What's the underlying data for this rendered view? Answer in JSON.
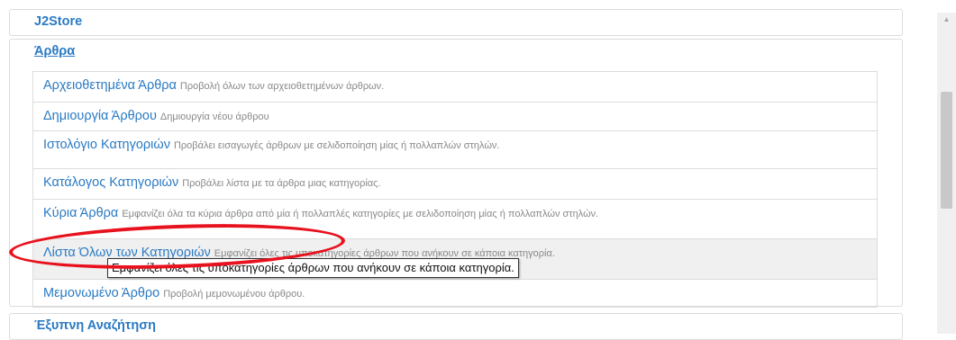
{
  "panels": {
    "j2store": {
      "title": "J2Store"
    },
    "arthra": {
      "title": "Άρθρα"
    },
    "search": {
      "title": "Έξυπνη Αναζήτηση"
    }
  },
  "articles": {
    "items": [
      {
        "name": "Αρχειοθετημένα Άρθρα",
        "desc": "Προβολή όλων των αρχειοθετημένων άρθρων."
      },
      {
        "name": "Δημιουργία Άρθρου",
        "desc": "Δημιουργία νέου άρθρου"
      },
      {
        "name": "Ιστολόγιο Κατηγοριών",
        "desc": "Προβάλει εισαγωγές άρθρων με σελιδοποίηση μίας ή πολλαπλών στηλών."
      },
      {
        "name": "Κατάλογος Κατηγοριών",
        "desc": "Προβάλει λίστα με τα άρθρα μιας κατηγορίας."
      },
      {
        "name": "Κύρια Άρθρα",
        "desc": "Εμφανίζει όλα τα κύρια άρθρα από μία ή πολλαπλές κατηγορίες με σελιδοποίηση μίας ή πολλαπλών στηλών."
      },
      {
        "name": "Λίστα Όλων των Κατηγοριών",
        "desc": "Εμφανίζει όλες τις υποκατηγορίες άρθρων που ανήκουν σε κάποια κατηγορία."
      },
      {
        "name": "Μεμονωμένο Άρθρο",
        "desc": "Προβολή μεμονωμένου άρθρου."
      }
    ],
    "highlighted_index": 5
  },
  "tooltip": {
    "text": "Εμφανίζει όλες τις υποκατηγορίες άρθρων που ανήκουν σε κάποια κατηγορία."
  },
  "colors": {
    "link": "#2a7ac3",
    "annotation": "#e8121e",
    "hover_bg": "#f0f0f0"
  }
}
